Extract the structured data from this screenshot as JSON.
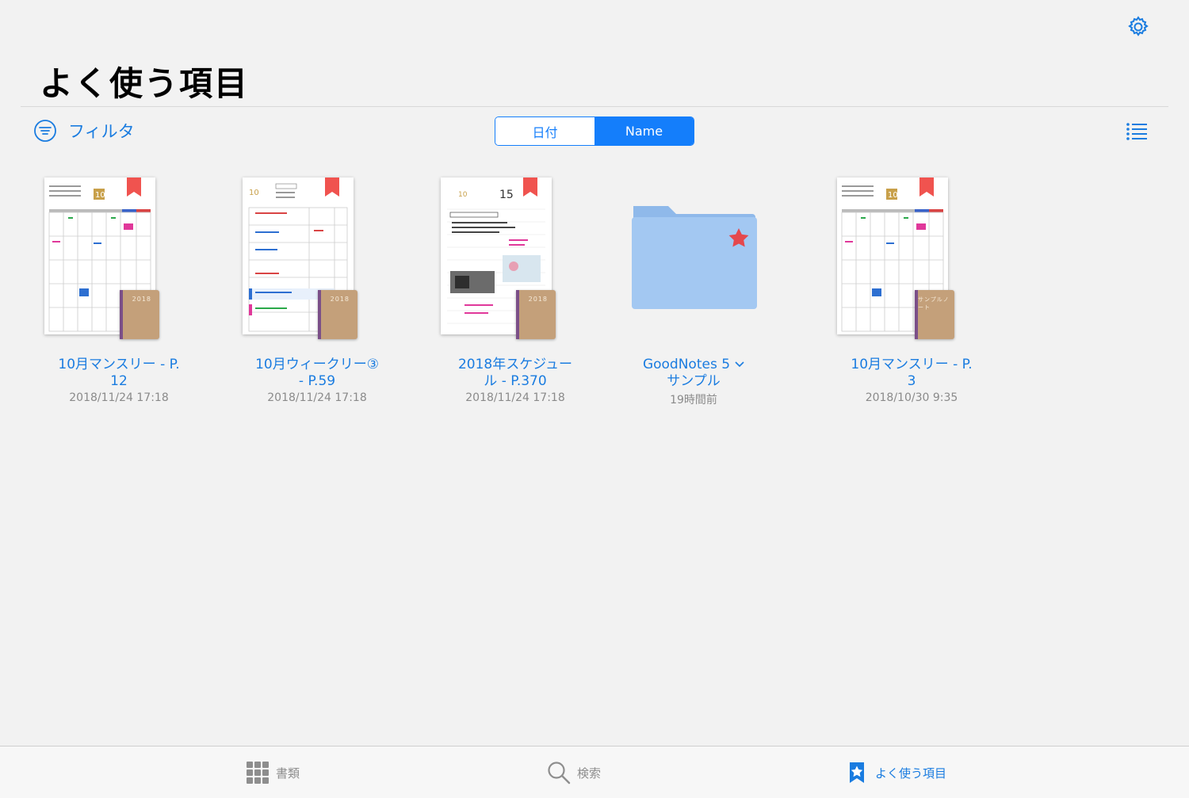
{
  "header": {
    "title": "よく使う項目",
    "settings_icon": "gear-icon"
  },
  "toolbar": {
    "filter_label": "フィルタ",
    "filter_icon": "filter-icon",
    "sort_options": [
      {
        "label": "日付",
        "selected": false
      },
      {
        "label": "Name",
        "selected": true
      }
    ],
    "view_icon": "list-view-icon"
  },
  "items": [
    {
      "type": "notebook",
      "title_line1": "10月マンスリー - P.",
      "title_line2": "12",
      "date": "2018/11/24 17:18",
      "cover_text": "2018",
      "page_style": "monthly"
    },
    {
      "type": "notebook",
      "title_line1": "10月ウィークリー③",
      "title_line2": "- P.59",
      "date": "2018/11/24 17:18",
      "cover_text": "2018",
      "page_style": "weekly"
    },
    {
      "type": "notebook",
      "title_line1": "2018年スケジュー",
      "title_line2": "ル - P.370",
      "date": "2018/11/24 17:18",
      "cover_text": "2018",
      "page_style": "daily"
    },
    {
      "type": "folder",
      "title_line1": "GoodNotes 5",
      "title_line2": "サンプル",
      "date": "19時間前"
    },
    {
      "type": "notebook",
      "title_line1": "10月マンスリー - P.",
      "title_line2": "3",
      "date": "2018/10/30 9:35",
      "cover_text": "サンプルノート",
      "page_style": "monthly"
    }
  ],
  "tabbar": [
    {
      "label": "書類",
      "icon": "grid-icon",
      "active": false
    },
    {
      "label": "検索",
      "icon": "search-icon",
      "active": false
    },
    {
      "label": "よく使う項目",
      "icon": "bookmark-star-icon",
      "active": true
    }
  ],
  "colors": {
    "accent": "#147efb",
    "bookmark_red": "#f0534f",
    "folder_blue": "#a3c8f2",
    "background": "#f2f2f2"
  }
}
